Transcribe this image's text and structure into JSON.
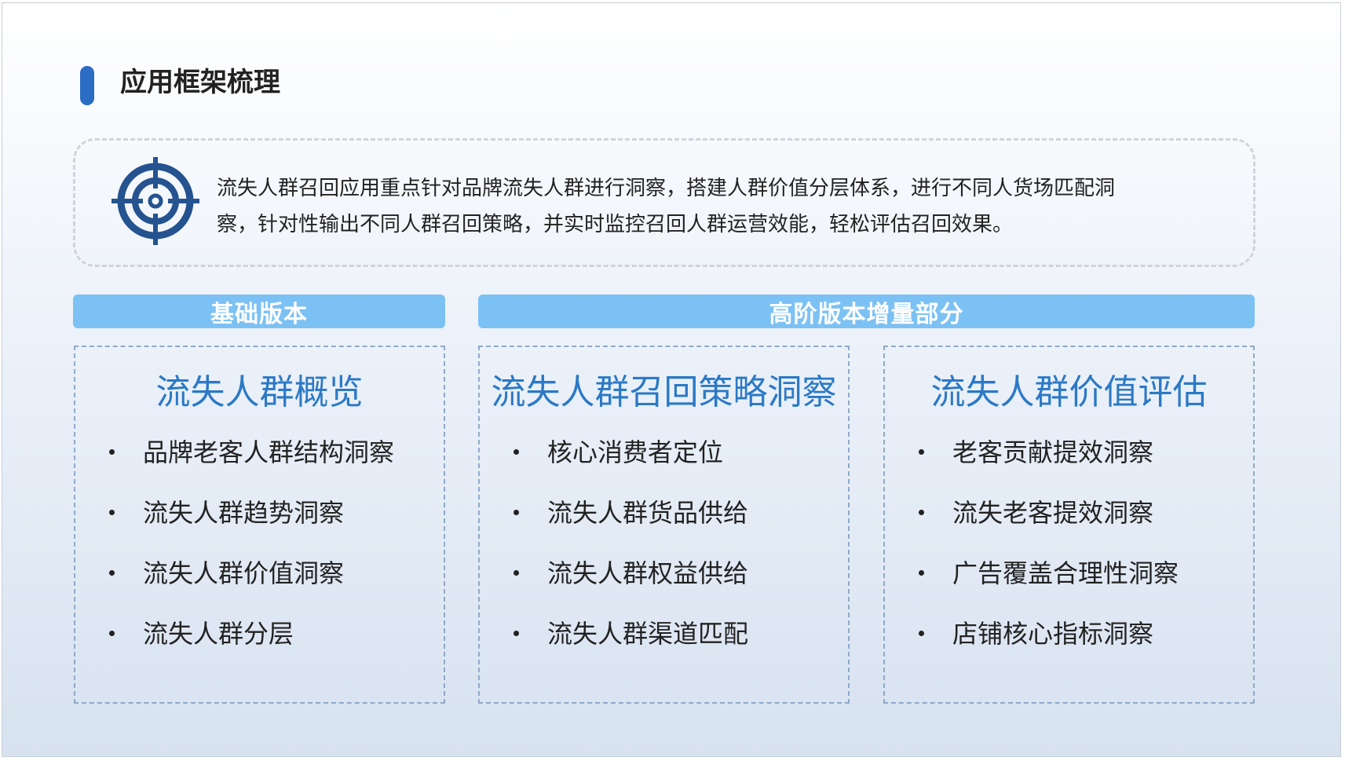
{
  "page": {
    "title": "应用框架梳理",
    "accent_color": "#2b6cc4",
    "band_color": "#7cc1f4",
    "heading_color": "#2b79c6"
  },
  "intro": {
    "icon": "target-icon",
    "line1": "流失人群召回应用重点针对品牌流失人群进行洞察，搭建人群价值分层体系，进行不同人货场匹配洞",
    "line2": "察，针对性输出不同人群召回策略，并实时监控召回人群运营效能，轻松评估召回效果。"
  },
  "bands": {
    "basic": "基础版本",
    "advanced": "高阶版本增量部分"
  },
  "columns": [
    {
      "title": "流失人群概览",
      "items": [
        "品牌老客人群结构洞察",
        "流失人群趋势洞察",
        "流失人群价值洞察",
        "流失人群分层"
      ]
    },
    {
      "title": "流失人群召回策略洞察",
      "items": [
        "核心消费者定位",
        "流失人群货品供给",
        "流失人群权益供给",
        "流失人群渠道匹配"
      ]
    },
    {
      "title": "流失人群价值评估",
      "items": [
        "老客贡献提效洞察",
        "流失老客提效洞察",
        "广告覆盖合理性洞察",
        "店铺核心指标洞察"
      ]
    }
  ]
}
